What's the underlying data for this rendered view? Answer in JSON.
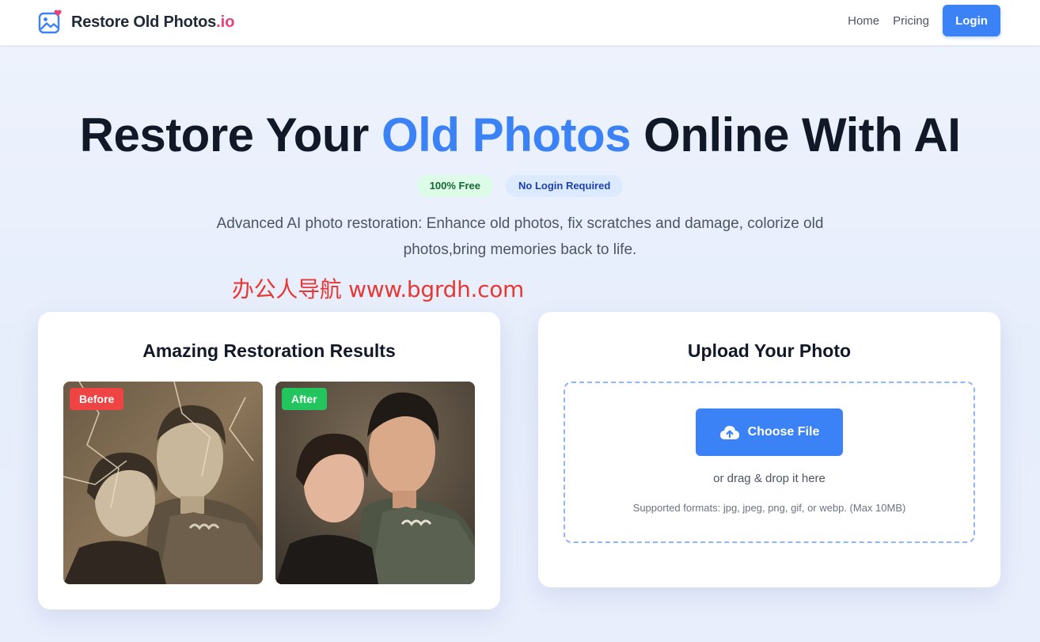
{
  "header": {
    "brand_name": "Restore Old Photos",
    "brand_suffix": ".io",
    "brand_icon": "photo-heart-icon",
    "nav": {
      "home": "Home",
      "pricing": "Pricing",
      "login": "Login"
    }
  },
  "hero": {
    "title_part1": "Restore Your ",
    "title_highlight": "Old Photos",
    "title_part2": " Online With AI",
    "badges": {
      "free": "100% Free",
      "no_login": "No Login Required"
    },
    "subtitle": "Advanced AI photo restoration: Enhance old photos, fix scratches and damage, colorize old photos,bring memories back to life."
  },
  "watermark": "办公人导航 www.bgrdh.com",
  "results": {
    "title": "Amazing Restoration Results",
    "before_label": "Before",
    "after_label": "After"
  },
  "upload": {
    "title": "Upload Your Photo",
    "button_label": "Choose File",
    "button_icon": "cloud-upload-icon",
    "drag_text": "or drag & drop it here",
    "formats_text": "Supported formats: jpg, jpeg, png, gif, or webp. (Max 10MB)"
  },
  "colors": {
    "accent": "#3b82f6",
    "brand_suffix": "#e8407a",
    "before_tag": "#ef4444",
    "after_tag": "#22c55e",
    "watermark": "#e53935"
  }
}
